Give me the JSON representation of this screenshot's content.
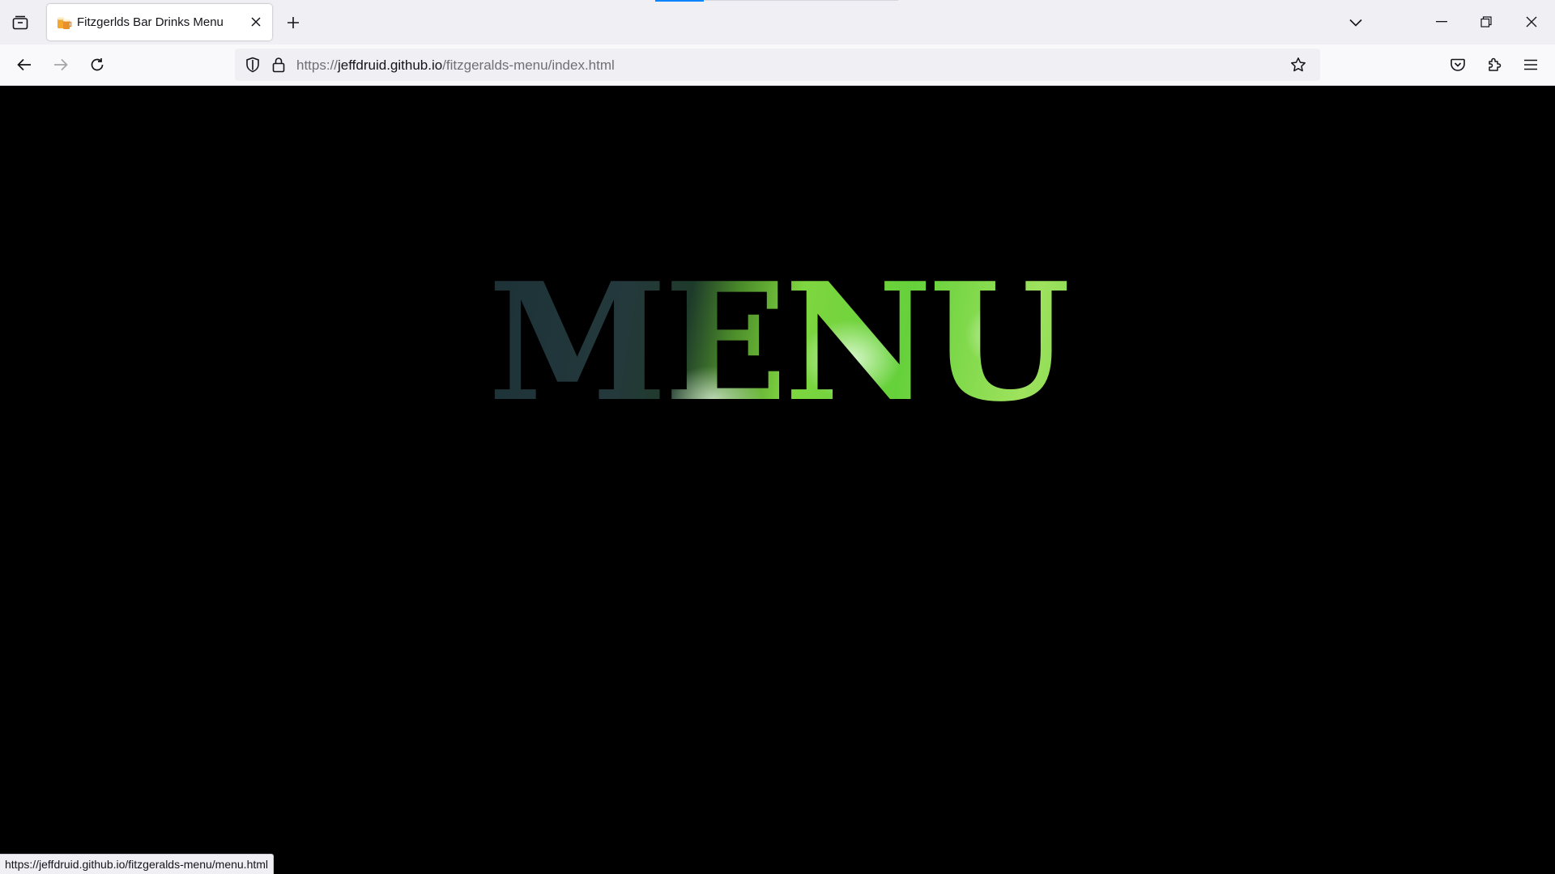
{
  "browser": {
    "tab": {
      "title": "Fitzgerlds Bar Drinks Menu",
      "favicon": "beer-mugs-icon"
    },
    "tab_manager_icon": "tab-manager-icon",
    "new_tab_icon": "plus-icon",
    "list_tabs_icon": "chevron-down-icon",
    "window_controls": [
      "minimize-icon",
      "restore-icon",
      "close-icon"
    ]
  },
  "navbar": {
    "back_icon": "arrow-left-icon",
    "forward_icon": "arrow-right-icon",
    "reload_icon": "reload-icon",
    "url": {
      "scheme": "https://",
      "host": "jeffdruid.github.io",
      "path": "/fitzgeralds-menu/index.html"
    },
    "tracking_protection_icon": "shield-icon",
    "lock_icon": "lock-icon",
    "bookmark_icon": "star-icon",
    "pocket_icon": "pocket-icon",
    "extensions_icon": "puzzle-icon",
    "menu_icon": "hamburger-icon"
  },
  "page": {
    "heading": "MENU",
    "background_color": "#000000"
  },
  "status_bar": {
    "link_url": "https://jeffdruid.github.io/fitzgeralds-menu/menu.html"
  },
  "colors": {
    "accent": "#0a84ff",
    "tabstrip_bg": "#f0f0f4",
    "heading_green": "#65d13a",
    "heading_dark": "#1c3136"
  }
}
